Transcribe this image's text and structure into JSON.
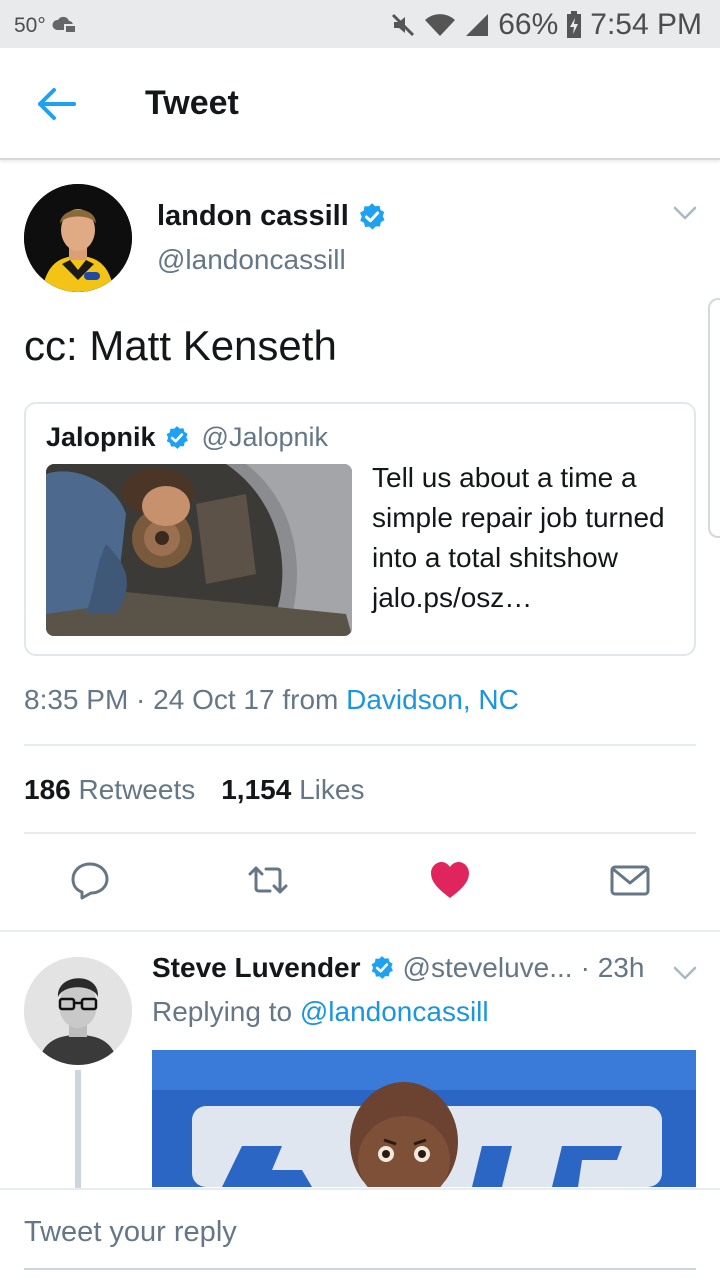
{
  "status_bar": {
    "temperature": "50°",
    "battery": "66%",
    "time": "7:54 PM"
  },
  "header": {
    "title": "Tweet",
    "back_icon": "arrow-left-icon"
  },
  "tweet": {
    "author_name": "landon cassill",
    "author_handle": "@landoncassill",
    "verified": true,
    "text": "cc: Matt Kenseth",
    "quoted": {
      "author_name": "Jalopnik",
      "author_handle": "@Jalopnik",
      "verified": true,
      "text": "Tell us about a time a simple repair job turned into a total shitshow jalo.ps/osz…"
    },
    "timestamp": "8:35 PM · 24 Oct 17",
    "from_label": "from",
    "location": "Davidson, NC",
    "stats": {
      "retweets_count": "186",
      "retweets_label": "Retweets",
      "likes_count": "1,154",
      "likes_label": "Likes"
    },
    "liked": true,
    "colors": {
      "accent": "#1da1f2",
      "like": "#e0245e",
      "secondary": "#657786"
    }
  },
  "reply": {
    "author_name": "Steve Luvender",
    "author_handle": "@steveluve...",
    "time": "· 23h",
    "verified": true,
    "replying_prefix": "Replying to",
    "replying_to": "@landoncassill"
  },
  "composer": {
    "placeholder": "Tweet your reply"
  }
}
